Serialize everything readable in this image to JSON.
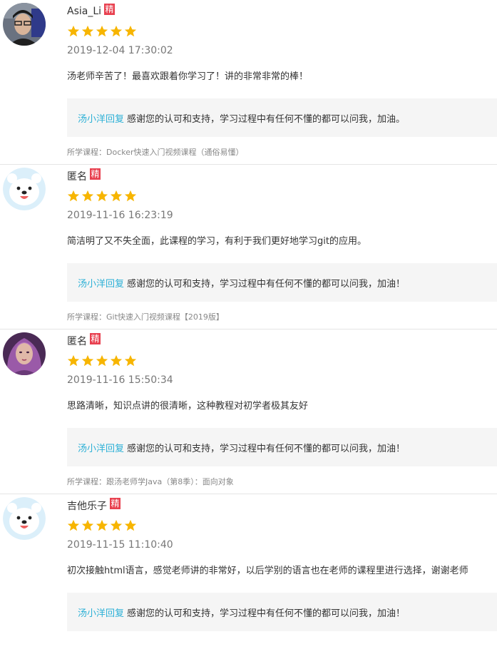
{
  "reviews": [
    {
      "username": "Asia_Li",
      "badge": "精",
      "rating": 5,
      "timestamp": "2019-12-04 17:30:02",
      "comment": "汤老师辛苦了！最喜欢跟着你学习了！讲的非常非常的棒！",
      "reply_author": "汤小洋回复",
      "reply_text": "感谢您的认可和支持，学习过程中有任何不懂的都可以问我，加油。",
      "course": "所学课程：Docker快速入门视频课程（通俗易懂）"
    },
    {
      "username": "匿名",
      "badge": "精",
      "rating": 5,
      "timestamp": "2019-11-16 16:23:19",
      "comment": "简洁明了又不失全面，此课程的学习，有利于我们更好地学习git的应用。",
      "reply_author": "汤小洋回复",
      "reply_text": "感谢您的认可和支持，学习过程中有任何不懂的都可以问我，加油！",
      "course": "所学课程：Git快速入门视频课程【2019版】"
    },
    {
      "username": "匿名",
      "badge": "精",
      "rating": 5,
      "timestamp": "2019-11-16 15:50:34",
      "comment": "思路清晰，知识点讲的很清晰，这种教程对初学者极其友好",
      "reply_author": "汤小洋回复",
      "reply_text": "感谢您的认可和支持，学习过程中有任何不懂的都可以问我，加油！",
      "course": "所学课程：跟汤老师学Java（第8季）：面向对象"
    },
    {
      "username": "吉他乐子",
      "badge": "精",
      "rating": 5,
      "timestamp": "2019-11-15 11:10:40",
      "comment": "初次接触html语言，感觉老师讲的非常好，以后学别的语言也在老师的课程里进行选择，谢谢老师",
      "reply_author": "汤小洋回复",
      "reply_text": "感谢您的认可和支持，学习过程中有任何不懂的都可以问我，加油！"
    }
  ],
  "colors": {
    "star": "#f7b500",
    "badge": "#e8404f",
    "reply_author": "#2bb0d6",
    "reply_bg": "#f5f5f5"
  }
}
